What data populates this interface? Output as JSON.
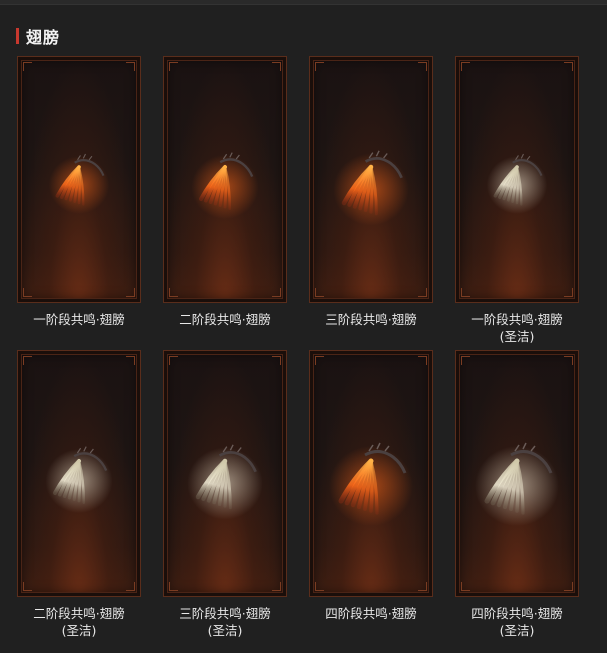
{
  "section": {
    "title": "翅膀"
  },
  "items": [
    {
      "name": "一阶段共鸣·翅膀",
      "sub": "",
      "variant": "fire",
      "scale": 0.72
    },
    {
      "name": "二阶段共鸣·翅膀",
      "sub": "",
      "variant": "fire",
      "scale": 0.8
    },
    {
      "name": "三阶段共鸣·翅膀",
      "sub": "",
      "variant": "fire",
      "scale": 0.9
    },
    {
      "name": "一阶段共鸣·翅膀",
      "sub": "(圣洁)",
      "variant": "holy",
      "scale": 0.72
    },
    {
      "name": "二阶段共鸣·翅膀",
      "sub": "(圣洁)",
      "variant": "holy",
      "scale": 0.8
    },
    {
      "name": "三阶段共鸣·翅膀",
      "sub": "(圣洁)",
      "variant": "holy",
      "scale": 0.9
    },
    {
      "name": "四阶段共鸣·翅膀",
      "sub": "",
      "variant": "fire",
      "scale": 1.0
    },
    {
      "name": "四阶段共鸣·翅膀",
      "sub": "(圣洁)",
      "variant": "holy",
      "scale": 1.0
    }
  ],
  "colors": {
    "accent_bar": "#c8382e",
    "fire_wing": [
      "#ff6a1a",
      "#ffb347",
      "#b83214"
    ],
    "holy_wing": [
      "#f2ecd6",
      "#cfc7a8",
      "#8c8670"
    ]
  }
}
